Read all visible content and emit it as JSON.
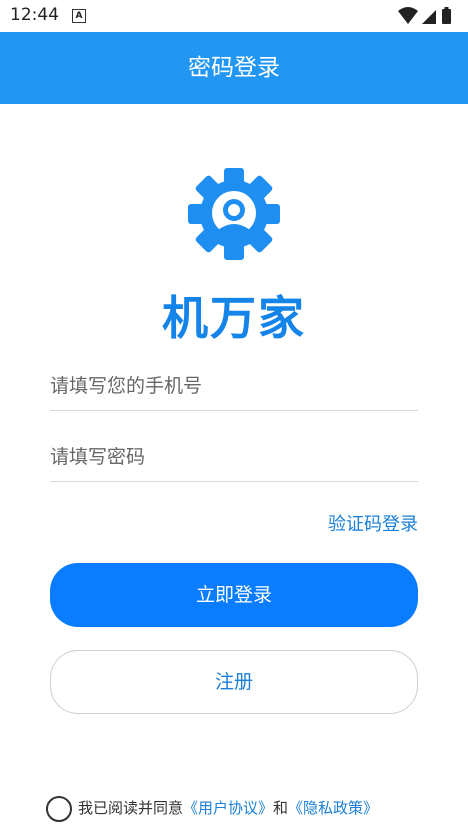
{
  "status_bar": {
    "time": "12:44",
    "notif_letter": "A"
  },
  "app_bar": {
    "title": "密码登录"
  },
  "brand": {
    "name": "机万家"
  },
  "form": {
    "phone_placeholder": "请填写您的手机号",
    "password_placeholder": "请填写密码",
    "code_login_link": "验证码登录",
    "login_button": "立即登录",
    "register_button": "注册"
  },
  "agreement": {
    "prefix": "我已阅读并同意",
    "user_agreement": "《用户协议》",
    "conjunction": "和",
    "privacy_policy": "《隐私政策》"
  },
  "colors": {
    "app_bar": "#2196f3",
    "brand": "#1584e8",
    "primary_button": "#0a7cff",
    "link": "#1a7fd6"
  }
}
